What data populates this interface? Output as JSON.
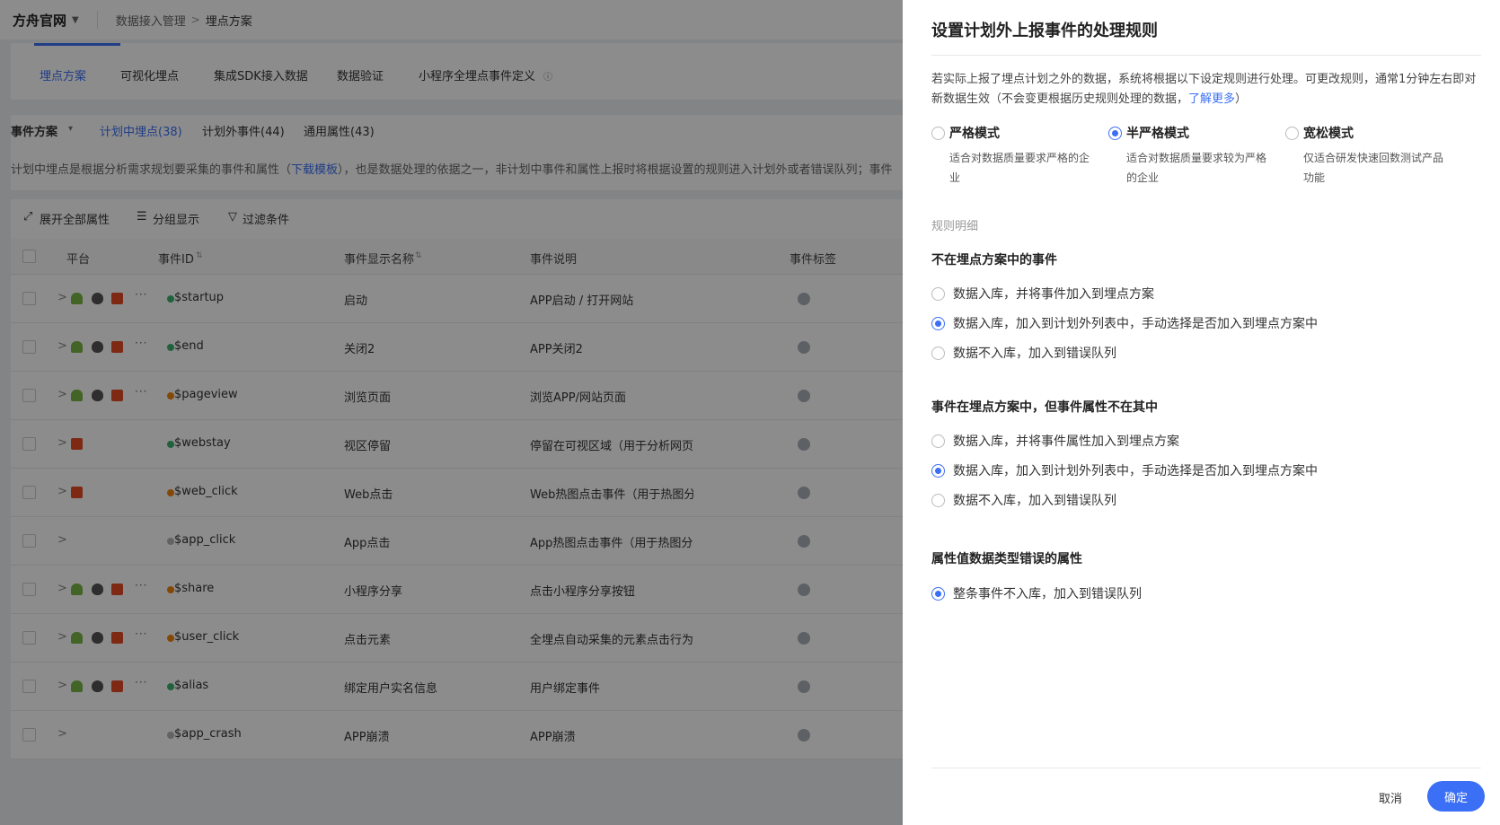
{
  "topbar": {
    "brand": "方舟官网",
    "crumb1": "数据接入管理",
    "crumb_sep": ">",
    "crumb2": "埋点方案"
  },
  "tabs": [
    "埋点方案",
    "可视化埋点",
    "集成SDK接入数据",
    "数据验证",
    "小程序全埋点事件定义"
  ],
  "subtabs": {
    "dropdown": "事件方案",
    "planned": "计划中埋点(38)",
    "unplanned": "计划外事件(44)",
    "common": "通用属性(43)"
  },
  "description": {
    "before": "计划中埋点是根据分析需求规划要采集的事件和属性（",
    "link": "下载模板",
    "after": "），也是数据处理的依据之一，非计划中事件和属性上报时将根据设置的规则进入计划外或者错误队列；事件"
  },
  "toolbar": {
    "expand": "展开全部属性",
    "group": "分组显示",
    "filter": "过滤条件"
  },
  "table": {
    "headers": {
      "platform": "平台",
      "event_id": "事件ID",
      "display_name": "事件显示名称",
      "description": "事件说明",
      "tags": "事件标签"
    },
    "rows": [
      {
        "platforms": [
          "android",
          "apple",
          "html"
        ],
        "more": "···",
        "status": "#3cb371",
        "id": "$startup",
        "name": "启动",
        "desc": "APP启动 / 打开网站"
      },
      {
        "platforms": [
          "android",
          "apple",
          "html"
        ],
        "more": "···",
        "status": "#3cb371",
        "id": "$end",
        "name": "关闭2",
        "desc": "APP关闭2"
      },
      {
        "platforms": [
          "android",
          "apple",
          "html"
        ],
        "more": "···",
        "status": "#f0830c",
        "id": "$pageview",
        "name": "浏览页面",
        "desc": "浏览APP/网站页面"
      },
      {
        "platforms": [
          "html"
        ],
        "more": "",
        "status": "#3cb371",
        "id": "$webstay",
        "name": "视区停留",
        "desc": "停留在可视区域（用于分析网页这"
      },
      {
        "platforms": [
          "html"
        ],
        "more": "",
        "status": "#f0830c",
        "id": "$web_click",
        "name": "Web点击",
        "desc": "Web热图点击事件（用于热图分析"
      },
      {
        "platforms": [],
        "more": "",
        "status": "#b5b5b5",
        "id": "$app_click",
        "name": "App点击",
        "desc": "App热图点击事件（用于热图分析"
      },
      {
        "platforms": [
          "android",
          "apple",
          "html"
        ],
        "more": "···",
        "status": "#f0830c",
        "id": "$share",
        "name": "小程序分享",
        "desc": "点击小程序分享按钮"
      },
      {
        "platforms": [
          "android",
          "apple",
          "html"
        ],
        "more": "···",
        "status": "#f0830c",
        "id": "$user_click",
        "name": "点击元素",
        "desc": "全埋点自动采集的元素点击行为"
      },
      {
        "platforms": [
          "android",
          "apple",
          "html"
        ],
        "more": "···",
        "status": "#3cb371",
        "id": "$alias",
        "name": "绑定用户实名信息",
        "desc": "用户绑定事件"
      },
      {
        "platforms": [],
        "more": "",
        "status": "#b5b5b5",
        "id": "$app_crash",
        "name": "APP崩溃",
        "desc": "APP崩溃"
      }
    ]
  },
  "drawer": {
    "title": "设置计划外上报事件的处理规则",
    "intro_before": "若实际上报了埋点计划之外的数据，系统将根据以下设定规则进行处理。可更改规则，通常1分钟左右即对新数据生效（不会变更根据历史规则处理的数据，",
    "intro_link": "了解更多",
    "intro_after": "）",
    "modes": [
      {
        "title": "严格模式",
        "desc": "适合对数据质量要求严格的企业",
        "selected": false
      },
      {
        "title": "半严格模式",
        "desc": "适合对数据质量要求较为严格的企业",
        "selected": true
      },
      {
        "title": "宽松模式",
        "desc": "仅适合研发快速回数测试产品功能",
        "selected": false
      }
    ],
    "rules_label": "规则明细",
    "sections": [
      {
        "title": "不在埋点方案中的事件",
        "options": [
          {
            "text": "数据入库，并将事件加入到埋点方案",
            "selected": false
          },
          {
            "text": "数据入库，加入到计划外列表中，手动选择是否加入到埋点方案中",
            "selected": true
          },
          {
            "text": "数据不入库，加入到错误队列",
            "selected": false
          }
        ]
      },
      {
        "title": "事件在埋点方案中，但事件属性不在其中",
        "options": [
          {
            "text": "数据入库，并将事件属性加入到埋点方案",
            "selected": false
          },
          {
            "text": "数据入库，加入到计划外列表中，手动选择是否加入到埋点方案中",
            "selected": true
          },
          {
            "text": "数据不入库，加入到错误队列",
            "selected": false
          }
        ]
      },
      {
        "title": "属性值数据类型错误的属性",
        "options": [
          {
            "text": "整条事件不入库，加入到错误队列",
            "selected": true
          }
        ]
      }
    ],
    "cancel": "取消",
    "confirm": "确定"
  },
  "colors": {
    "accent": "#3b6ff5",
    "overlay": "rgba(0,0,0,0.45)"
  }
}
